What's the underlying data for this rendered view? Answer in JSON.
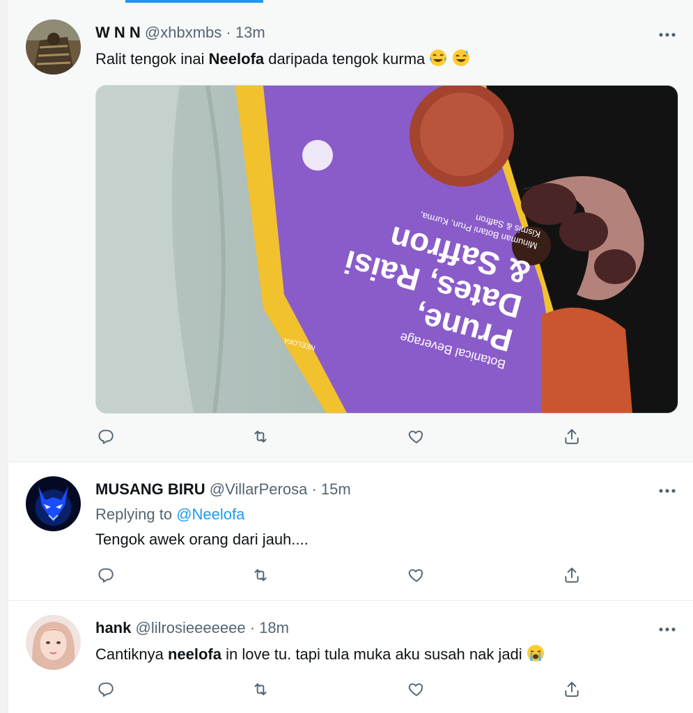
{
  "tweets": [
    {
      "name": "W N N",
      "handle": "@xhbxmbs",
      "separator": "·",
      "time": "13m",
      "text_before": "Ralit tengok inai ",
      "text_bold": "Neelofa",
      "text_after": " daripada tengok kurma",
      "emojis": [
        "tears-of-joy-emoji",
        "sweat-smile-emoji"
      ],
      "media": {
        "product_lines": [
          "Botanical Beverage",
          "Prune,",
          "Dates, Raisi",
          "& Saffron",
          "Minuman Botani Prun, Kurma,",
          "Kismis & Saffron"
        ],
        "brand": "NEELOFA"
      }
    },
    {
      "name": "MUSANG BIRU",
      "handle": "@VillarPerosa",
      "separator": "·",
      "time": "15m",
      "replying_label": "Replying to ",
      "replying_to": "@Neelofa",
      "text": "Tengok awek orang dari jauh...."
    },
    {
      "name": "hank",
      "handle": "@lilrosieeeeeee",
      "separator": "·",
      "time": "18m",
      "text_before": "Cantiknya ",
      "text_bold": "neelofa",
      "text_after": " in love tu. tapi tula muka aku susah nak jadi",
      "emojis": [
        "loudly-crying-emoji"
      ]
    }
  ],
  "icons": {
    "reply": "reply-icon",
    "retweet": "retweet-icon",
    "like": "like-icon",
    "share": "share-icon",
    "more": "more-icon"
  },
  "colors": {
    "accent": "#1d9bf0",
    "secondary_text": "#536471",
    "media_purple": "#8a5cc9",
    "media_yellow": "#f2c12e"
  }
}
